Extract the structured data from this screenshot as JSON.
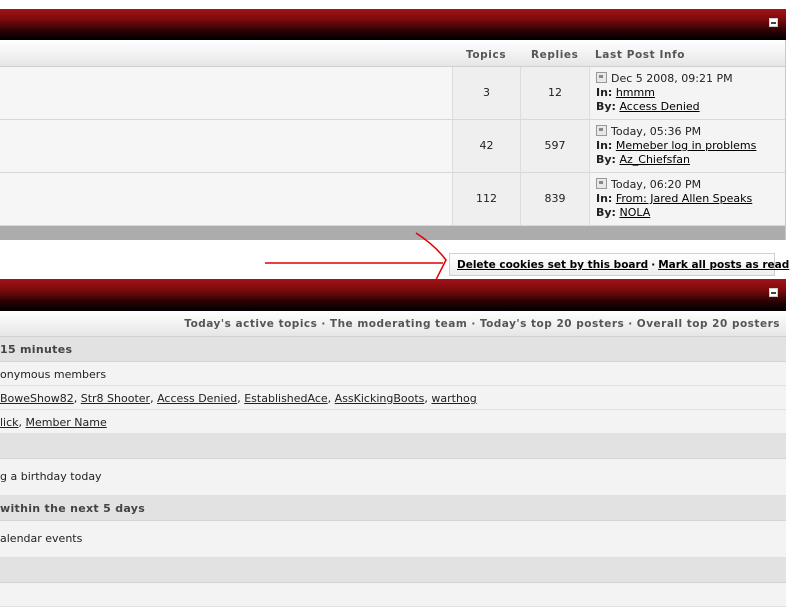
{
  "forum_table": {
    "headers": {
      "topics": "Topics",
      "replies": "Replies",
      "last_post": "Last Post Info"
    },
    "rows": [
      {
        "topics": "3",
        "replies": "12",
        "date": "Dec 5 2008, 09:21 PM",
        "in_label": "In:",
        "in_link": "hmmm",
        "by_label": "By:",
        "by_link": "Access Denied"
      },
      {
        "topics": "42",
        "replies": "597",
        "date": "Today, 05:36 PM",
        "in_label": "In:",
        "in_link": "Memeber log in problems",
        "by_label": "By:",
        "by_link": "Az_Chiefsfan"
      },
      {
        "topics": "112",
        "replies": "839",
        "date": "Today, 06:20 PM",
        "in_label": "In:",
        "in_link": "From: Jared Allen Speaks",
        "by_label": "By:",
        "by_link": "NOLA"
      }
    ]
  },
  "actions": {
    "delete_cookies": "Delete cookies set by this board",
    "separator": "·",
    "mark_read": "Mark all posts as read"
  },
  "stats": {
    "links": [
      "Today's active topics",
      "The moderating team",
      "Today's top 20 posters",
      "Overall top 20 posters"
    ],
    "link_separator": "·",
    "active_header": "15 minutes",
    "anon_text": "onymous members",
    "members": [
      "BoweShow82",
      "Str8 Shooter",
      "Access Denied",
      "EstablishedAce",
      "AssKickingBoots",
      "warthog"
    ],
    "members_sep": ",",
    "recent": [
      "lick",
      "Member Name"
    ],
    "birthday_text": "g a birthday today",
    "upcoming_header": "within the next 5 days",
    "calendar_text": "alendar events"
  },
  "colors": {
    "bar_red": "#a41218",
    "annotation_red": "#e00000"
  }
}
